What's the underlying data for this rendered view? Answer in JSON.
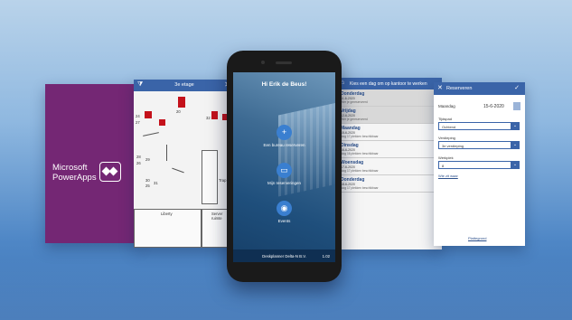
{
  "powerapps": {
    "line1": "Microsoft",
    "line2": "PowerApps"
  },
  "floor_map": {
    "title": "3e etage",
    "rooms": [
      "Liberty",
      "Server ruimte"
    ],
    "trap": "Trap",
    "desk_numbers": [
      "24",
      "27",
      "20",
      "28",
      "29",
      "26",
      "30",
      "25",
      "31",
      "32"
    ]
  },
  "phone": {
    "greeting": "Hi Erik de Beus!",
    "actions": [
      {
        "label": "Een bureau reserveren",
        "icon": "+"
      },
      {
        "label": "Mijn reserveringen",
        "icon": "▭"
      },
      {
        "label": "Events",
        "icon": "◉"
      }
    ],
    "footer_left": "Deskplanner Delta-N B.V.",
    "footer_right": "1.02"
  },
  "day_list": {
    "title": "Kies een dag om op kantoor te werken",
    "days": [
      {
        "name": "Donderdag",
        "date": "11-6-2020",
        "status": "Hier je gereserveerd",
        "selected": true
      },
      {
        "name": "Vrijdag",
        "date": "12-6-2020",
        "status": "Hier je gereserveerd",
        "selected": true
      },
      {
        "name": "Maandag",
        "date": "15-6-2020",
        "status": "Nog 17 plekken beschikbaar",
        "selected": false
      },
      {
        "name": "Dinsdag",
        "date": "16-6-2020",
        "status": "Nog 16 plekken beschikbaar",
        "selected": false
      },
      {
        "name": "Woensdag",
        "date": "17-6-2020",
        "status": "Nog 17 plekken beschikbaar",
        "selected": false
      },
      {
        "name": "Donderdag",
        "date": "18-6-2020",
        "status": "Nog 17 plekken beschikbaar",
        "selected": false
      }
    ]
  },
  "reserve": {
    "title": "Reserveren",
    "day_label": "Maandag",
    "date": "15-6-2020",
    "fields": [
      {
        "label": "Tijdspad",
        "value": "Ochtend"
      },
      {
        "label": "Verdieping",
        "value": "3e verdieping"
      },
      {
        "label": "Werkplek",
        "value": "8"
      }
    ],
    "link": "Wie zit waar",
    "bottom_link": "Plattegrond"
  }
}
